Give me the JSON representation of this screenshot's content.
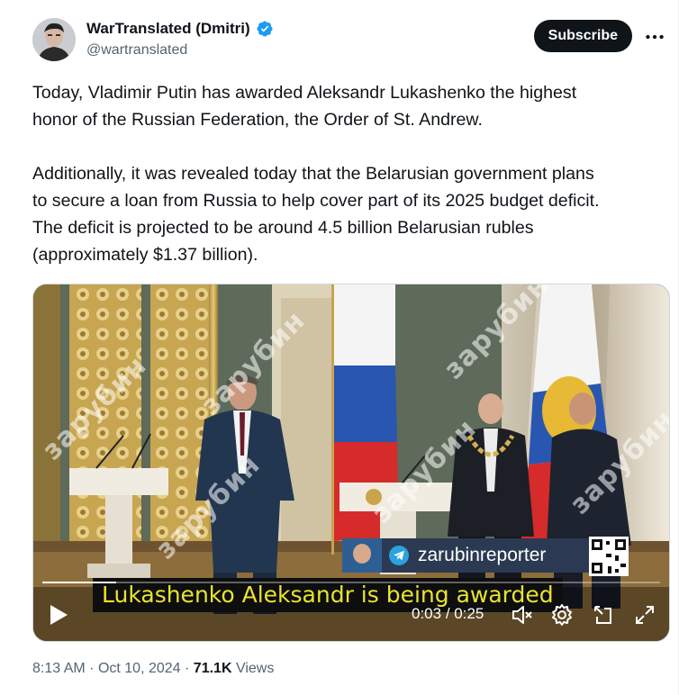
{
  "author": {
    "display_name": "WarTranslated (Dmitri)",
    "handle": "@wartranslated",
    "verified": true
  },
  "actions": {
    "subscribe_label": "Subscribe",
    "more_icon": "more-horizontal-icon"
  },
  "tweet": {
    "paragraph1": [
      "Today, Vladimir Putin has awarded Aleksandr Lukashenko the highest",
      "honor of the Russian Federation, the Order of St. Andrew."
    ],
    "paragraph2": [
      "Additionally, it was revealed today that the Belarusian government plans",
      "to secure a loan from Russia to help cover part of its 2025 budget deficit.",
      "The deficit is projected to be around 4.5 billion Belarusian rubles",
      "(approximately $1.37 billion)."
    ]
  },
  "video": {
    "watermark_text": "зарубин",
    "promo_handle": "zarubinreporter",
    "caption": "Lukashenko Aleksandr is being awarded",
    "time_current": "0:03",
    "time_separator": " / ",
    "time_total": "0:25",
    "progress": 0.12,
    "controls": [
      "play-icon",
      "muted-speaker-icon",
      "settings-gear-icon",
      "pop-out-icon",
      "fullscreen-icon"
    ]
  },
  "meta": {
    "time": "8:13 AM",
    "date": "Oct 10, 2024",
    "separator": "·",
    "views_count": "71.1K",
    "views_label": "Views"
  },
  "colors": {
    "subscribe_bg": "#0f1419",
    "verified_blue": "#1d9bf0",
    "secondary_text": "#536471",
    "caption_text": "#e8e330"
  }
}
